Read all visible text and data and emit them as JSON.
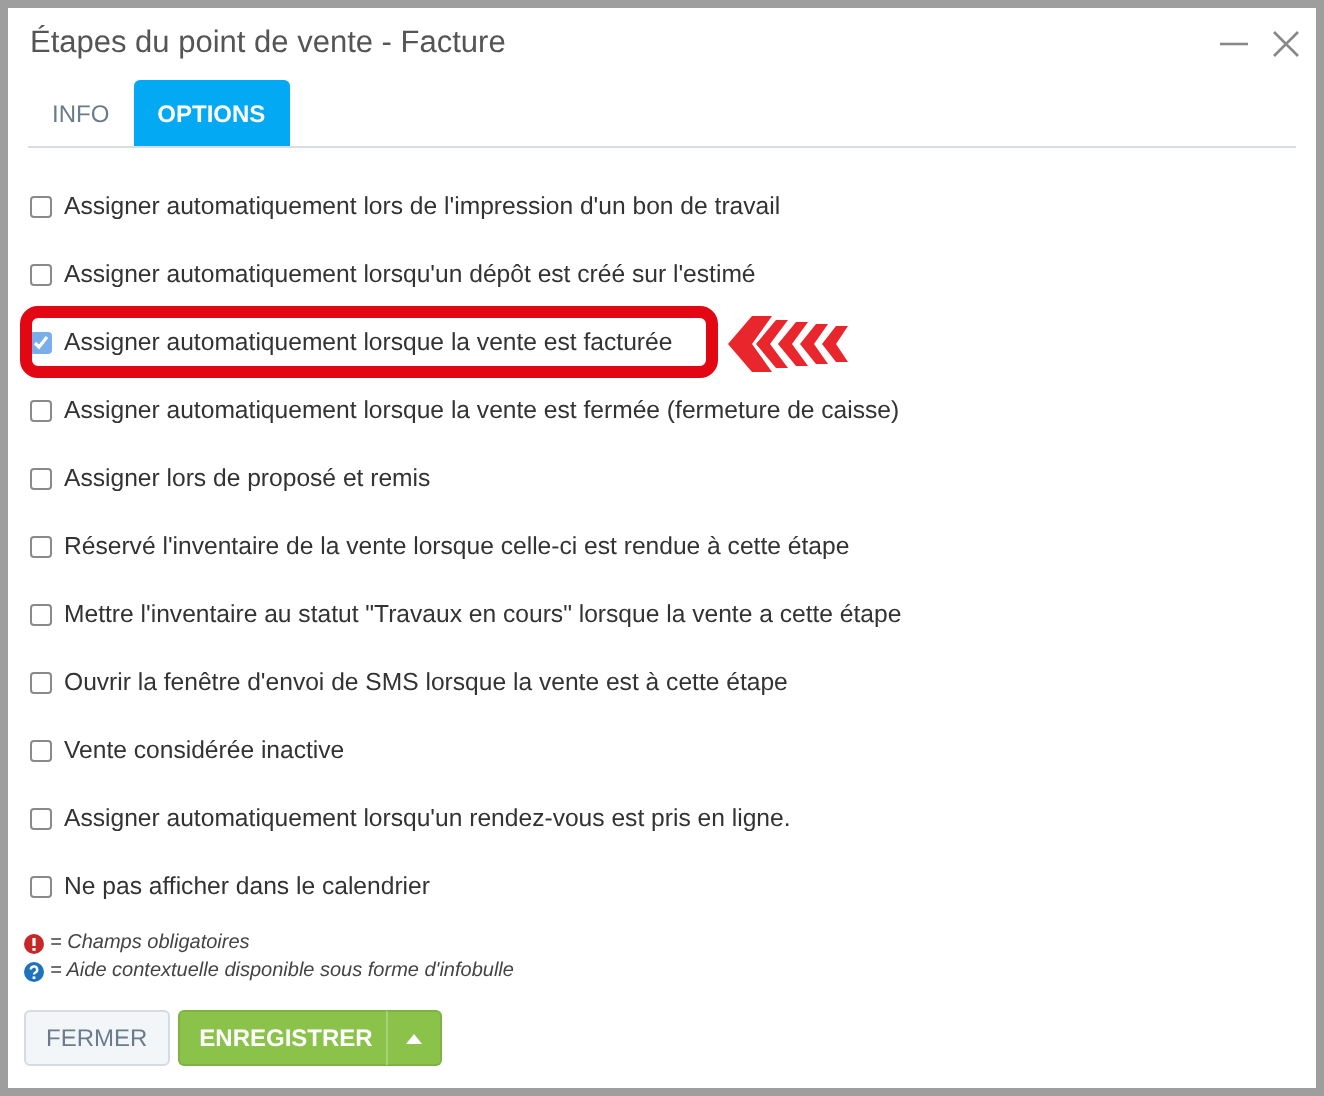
{
  "window": {
    "title": "Étapes du point de vente - Facture"
  },
  "tabs": [
    {
      "label": "INFO",
      "selected": false
    },
    {
      "label": "OPTIONS",
      "selected": true
    }
  ],
  "options": [
    {
      "label": "Assigner automatiquement lors de l'impression d'un bon de travail",
      "checked": false,
      "highlighted": false
    },
    {
      "label": "Assigner automatiquement lorsqu'un dépôt est créé sur l'estimé",
      "checked": false,
      "highlighted": false
    },
    {
      "label": "Assigner automatiquement lorsque la vente est facturée",
      "checked": true,
      "highlighted": true
    },
    {
      "label": "Assigner automatiquement lorsque la vente est fermée (fermeture de caisse)",
      "checked": false,
      "highlighted": false
    },
    {
      "label": "Assigner lors de proposé et remis",
      "checked": false,
      "highlighted": false
    },
    {
      "label": "Réservé l'inventaire de la vente lorsque celle-ci est rendue à cette étape",
      "checked": false,
      "highlighted": false
    },
    {
      "label": "Mettre l'inventaire au statut \"Travaux en cours\" lorsque la vente a cette étape",
      "checked": false,
      "highlighted": false
    },
    {
      "label": "Ouvrir la fenêtre d'envoi de SMS lorsque la vente est à cette étape",
      "checked": false,
      "highlighted": false
    },
    {
      "label": "Vente considérée inactive",
      "checked": false,
      "highlighted": false
    },
    {
      "label": "Assigner automatiquement lorsqu'un rendez-vous est pris en ligne.",
      "checked": false,
      "highlighted": false
    },
    {
      "label": "Ne pas afficher dans le calendrier",
      "checked": false,
      "highlighted": false
    }
  ],
  "legend": [
    {
      "kind": "required",
      "text": "= Champs obligatoires"
    },
    {
      "kind": "help",
      "text": "= Aide contextuelle disponible sous forme d'infobulle"
    }
  ],
  "buttons": [
    {
      "kind": "secondary",
      "label": "FERMER"
    },
    {
      "kind": "primary",
      "label": "ENREGISTRER"
    }
  ]
}
